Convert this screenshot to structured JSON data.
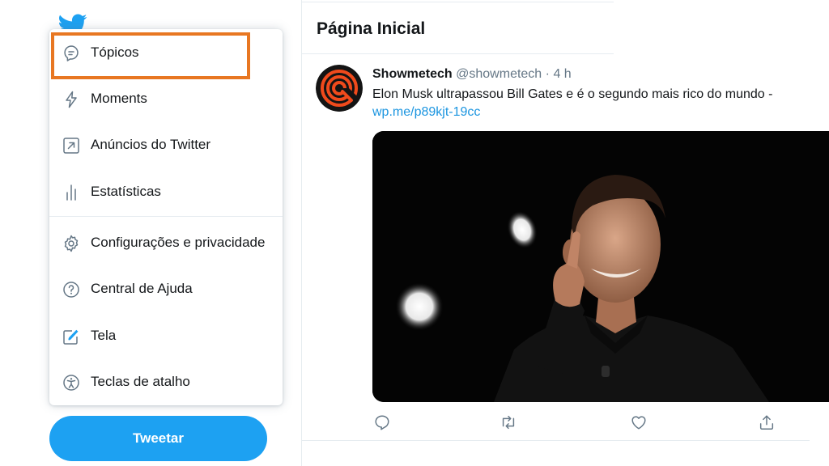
{
  "menu": {
    "items": [
      {
        "label": "Tópicos",
        "icon": "topics-icon"
      },
      {
        "label": "Moments",
        "icon": "lightning-icon"
      },
      {
        "label": "Anúncios do Twitter",
        "icon": "ads-icon"
      },
      {
        "label": "Estatísticas",
        "icon": "analytics-icon"
      },
      {
        "label": "Configurações e privacidade",
        "icon": "gear-icon"
      },
      {
        "label": "Central de Ajuda",
        "icon": "help-icon"
      },
      {
        "label": "Tela",
        "icon": "display-icon"
      },
      {
        "label": "Teclas de atalho",
        "icon": "accessibility-icon"
      }
    ]
  },
  "tweet_button": {
    "label": "Tweetar"
  },
  "header": {
    "title": "Página Inicial"
  },
  "tweet": {
    "author_name": "Showmetech",
    "handle": "@showmetech",
    "separator": "·",
    "time": "4 h",
    "text": "Elon Musk ultrapassou Bill Gates e é o segundo mais rico do mundo -",
    "link": "wp.me/p89kjt-19cc"
  },
  "colors": {
    "accent": "#1da1f2",
    "link": "#1b95e0",
    "highlight": "#e87722",
    "muted": "#657786"
  }
}
